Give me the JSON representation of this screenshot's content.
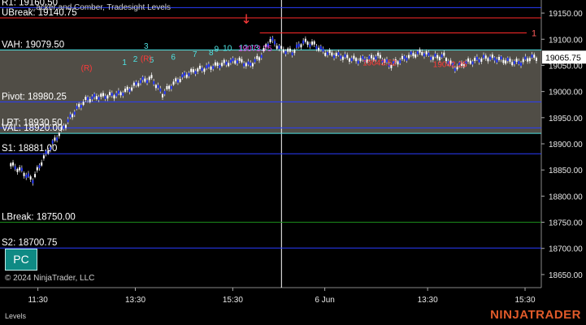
{
  "window": {
    "title": "...acker and Comber, Tradesight Levels",
    "copyright": "© 2024 NinjaTrader, LLC",
    "brand": "NINJATRADER",
    "footer_label": "Levels",
    "pc_button": "PC"
  },
  "chart_data": {
    "type": "candlestick",
    "ylim": [
      18625,
      19175
    ],
    "y_ticks": [
      19150,
      19100,
      19050,
      19000,
      18950,
      18900,
      18850,
      18800,
      18750,
      18700,
      18650
    ],
    "y_tick_labels": [
      "19150.00",
      "19100.00",
      "19050.00",
      "19000.00",
      "18950.00",
      "18900.00",
      "18850.00",
      "18800.00",
      "18750.00",
      "18700.00",
      "18650.00"
    ],
    "x_ticks": [
      {
        "label": "11:30",
        "pos": 0.07
      },
      {
        "label": "13:30",
        "pos": 0.25
      },
      {
        "label": "15:30",
        "pos": 0.43
      },
      {
        "label": "6 Jun",
        "pos": 0.6
      },
      {
        "label": "13:30",
        "pos": 0.79
      },
      {
        "label": "15:30",
        "pos": 0.97
      }
    ],
    "current_price": "19065.75",
    "session_divider": 0.52,
    "value_area": {
      "high": 19079.5,
      "low": 18920
    },
    "levels": [
      {
        "label": "R1: 19160.50",
        "price": 19160.5,
        "color": "#2a3cff"
      },
      {
        "label": "UBreak: 19140.75",
        "price": 19140.75,
        "color": "#ff2a2a"
      },
      {
        "label": "VAH: 19079.50",
        "price": 19079.5,
        "color": "#4fe3e3"
      },
      {
        "label": "Pivot: 18980.25",
        "price": 18980.25,
        "color": "#2a3cff"
      },
      {
        "label": "LRT: 18930.50",
        "price": 18930.5,
        "color": "#2a3cff"
      },
      {
        "label": "VAL: 18920.00",
        "price": 18920,
        "color": "#4fe3e3"
      },
      {
        "label": "S1: 18881.00",
        "price": 18881,
        "color": "#2a3cff"
      },
      {
        "label": "LBreak: 18750.00",
        "price": 18750,
        "color": "#1a8a1a"
      },
      {
        "label": "S2: 18700.75",
        "price": 18700.75,
        "color": "#2a3cff"
      }
    ],
    "red_line": {
      "price": 19112,
      "from": 0.48,
      "label": "1"
    },
    "annotations": [
      {
        "text": "19073.75",
        "x": 0.44,
        "price": 19077,
        "color": "#e040e0"
      },
      {
        "text": "19043.52",
        "x": 0.67,
        "price": 19050,
        "color": "#ff3a3a"
      },
      {
        "text": "19042.25",
        "x": 0.8,
        "price": 19047,
        "color": "#ff3a3a"
      }
    ],
    "count_labels": [
      {
        "text": "1",
        "x": 0.23,
        "price": 19051,
        "color": "#4fe3e3"
      },
      {
        "text": "2",
        "x": 0.25,
        "price": 19057,
        "color": "#4fe3e3"
      },
      {
        "text": "3",
        "x": 0.27,
        "price": 19082,
        "color": "#4fe3e3"
      },
      {
        "text": "5",
        "x": 0.28,
        "price": 19055,
        "color": "#4fe3e3"
      },
      {
        "text": "6",
        "x": 0.32,
        "price": 19061,
        "color": "#4fe3e3"
      },
      {
        "text": "7",
        "x": 0.36,
        "price": 19066,
        "color": "#4fe3e3"
      },
      {
        "text": "8",
        "x": 0.39,
        "price": 19069,
        "color": "#4fe3e3"
      },
      {
        "text": "9",
        "x": 0.4,
        "price": 19076,
        "color": "#4fe3e3"
      },
      {
        "text": "10",
        "x": 0.42,
        "price": 19078,
        "color": "#4fe3e3"
      },
      {
        "text": "12",
        "x": 0.45,
        "price": 19079,
        "color": "#4fe3e3"
      },
      {
        "text": "13",
        "x": 0.47,
        "price": 19079,
        "color": "#4fe3e3"
      },
      {
        "text": "(R)",
        "x": 0.16,
        "price": 19040,
        "color": "#ff3a3a"
      },
      {
        "text": "(R)",
        "x": 0.27,
        "price": 19058,
        "color": "#ff3a3a"
      }
    ]
  }
}
